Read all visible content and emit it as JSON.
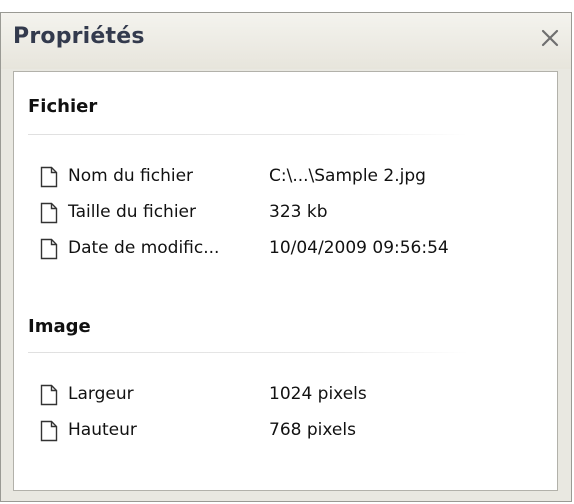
{
  "panel": {
    "title": "Propriétés",
    "close_icon": "close-icon"
  },
  "sections": {
    "file": {
      "header": "Fichier",
      "rows": [
        {
          "label": "Nom du fichier",
          "value": "C:\\...\\Sample 2.jpg",
          "icon": "file-icon"
        },
        {
          "label": "Taille du fichier",
          "value": "323 kb",
          "icon": "file-icon"
        },
        {
          "label": "Date de modific...",
          "value": "10/04/2009 09:56:54",
          "icon": "file-icon"
        }
      ]
    },
    "image": {
      "header": "Image",
      "rows": [
        {
          "label": "Largeur",
          "value": "1024 pixels",
          "icon": "file-icon"
        },
        {
          "label": "Hauteur",
          "value": "768 pixels",
          "icon": "file-icon"
        }
      ]
    }
  },
  "colors": {
    "title_text": "#333a4d",
    "panel_background": "#e9e8e1",
    "content_background": "#ffffff",
    "border": "#9a9a94"
  }
}
